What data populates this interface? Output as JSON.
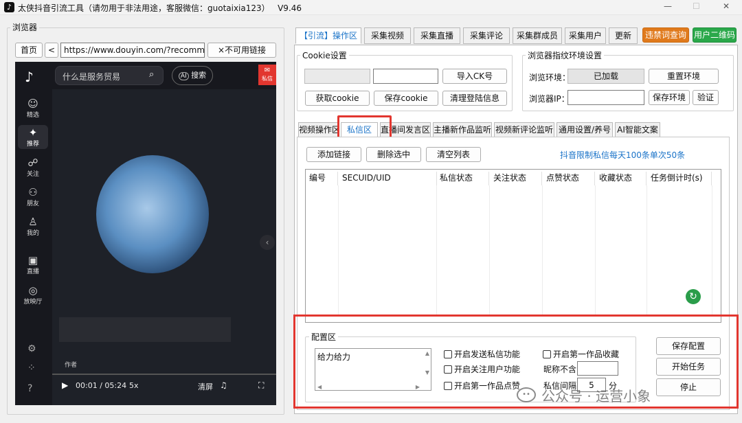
{
  "window": {
    "title": "太侠抖音引流工具（请勿用于非法用途，客服微信：guotaixia123）   V9.46",
    "controls": {
      "minimize": "—",
      "maximize": "☐",
      "close": "✕"
    }
  },
  "browser": {
    "label": "浏览器",
    "home": "首页",
    "back": "<",
    "url": "https://www.douyin.com/?recommend",
    "unavailable": "×不可用链接"
  },
  "douyin": {
    "search_placeholder": "什么是服务贸易",
    "search_btn": "搜索",
    "ai_badge": "AI",
    "msg_label": "私信",
    "nav": [
      "精选",
      "推荐",
      "关注",
      "朋友",
      "我的",
      "直播",
      "放映厅"
    ],
    "author_prefix": "作者",
    "time": "00:01 / 05:24",
    "speed": "5x",
    "clear": "清屏"
  },
  "main_tabs": [
    "【引流】操作区",
    "采集视频",
    "采集直播",
    "采集评论",
    "采集群成员",
    "采集用户",
    "更新"
  ],
  "main_tab_active": 0,
  "btn_forbidden": "违禁词查询",
  "btn_qrcode": "用户二维码",
  "colors": {
    "forbidden": "#e07a1c",
    "qrcode": "#2aa84a",
    "link_blue": "#1a73c8",
    "highlight_red": "#e2362f",
    "refresh_green": "#2a9d4a"
  },
  "cookie": {
    "label": "Cookie设置",
    "import": "导入CK号",
    "get": "获取cookie",
    "save": "保存cookie",
    "clear": "清理登陆信息"
  },
  "env": {
    "label": "浏览器指纹环境设置",
    "env_label": "浏览环境：",
    "env_value": "已加载",
    "reset": "重置环境",
    "ip_label": "浏览器IP：",
    "save": "保存环境",
    "verify": "验证"
  },
  "sub_tabs": [
    "视频操作区",
    "私信区",
    "直播间发言区",
    "主播新作品监听",
    "视频新评论监听",
    "通用设置/养号",
    "AI智能文案"
  ],
  "sub_tab_active": 1,
  "toolbar": {
    "add": "添加链接",
    "delete": "删除选中",
    "clear": "清空列表",
    "limit_note": "抖音限制私信每天100条单次50条"
  },
  "table": {
    "columns": [
      "编号",
      "SECUID/UID",
      "私信状态",
      "关注状态",
      "点赞状态",
      "收藏状态",
      "任务倒计时(s)"
    ],
    "rows": []
  },
  "config": {
    "label": "配置区",
    "message_text": "给力给力",
    "checks": [
      "开启发送私信功能",
      "开启第一作品收藏",
      "开启关注用户功能",
      "开启第一作品点赞"
    ],
    "nickname_label": "昵称不含",
    "interval_label": "私信间隔",
    "interval_value": "5",
    "interval_unit": "分",
    "save": "保存配置",
    "start": "开始任务",
    "stop": "停止"
  },
  "watermark": "公众号 · 运营小象"
}
